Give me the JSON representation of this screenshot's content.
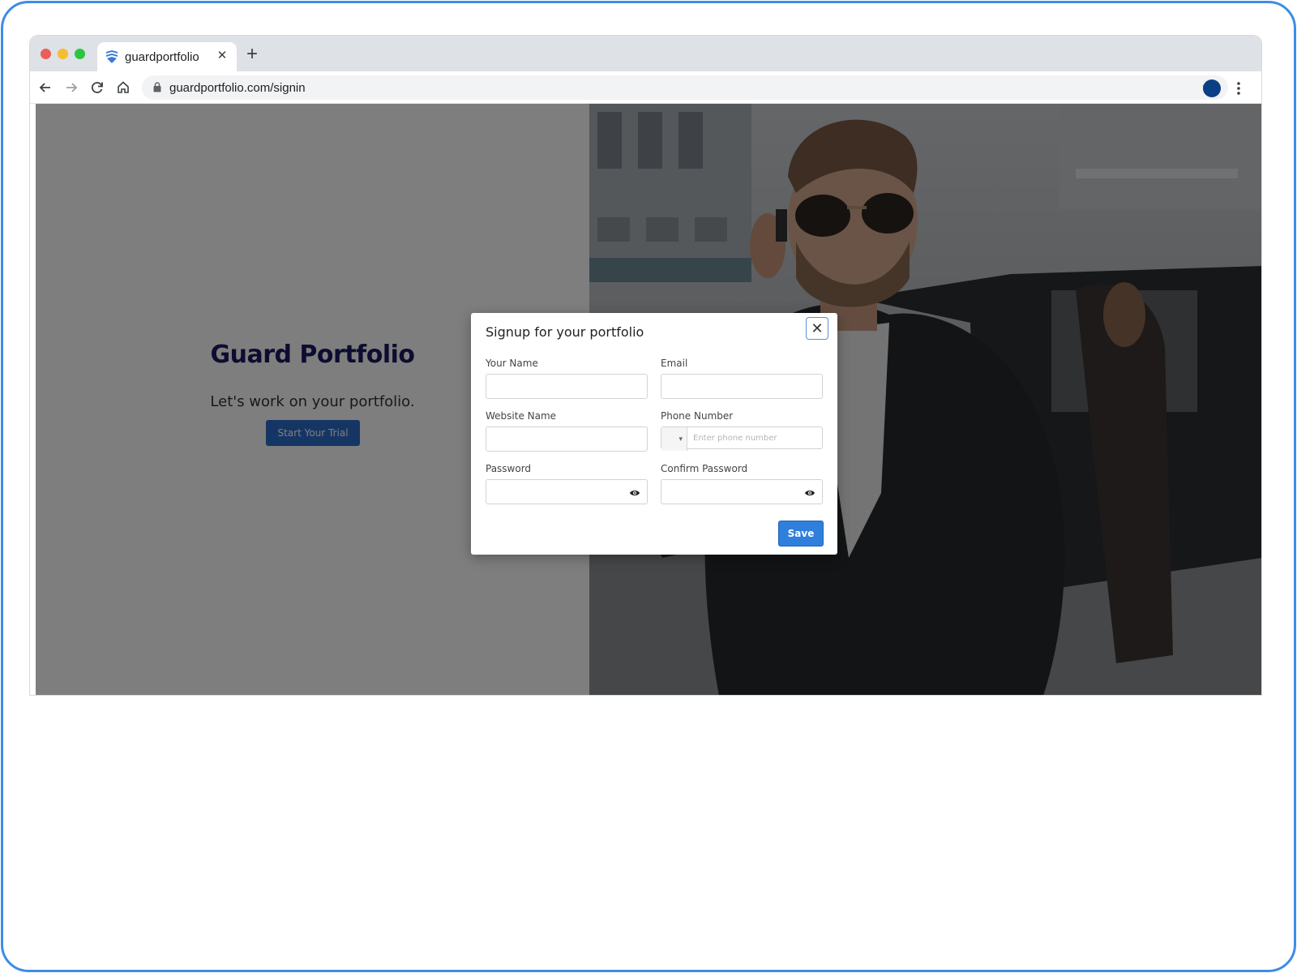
{
  "browser": {
    "tab_title": "guardportfolio",
    "tab_close": "✕",
    "new_tab": "+",
    "url": "guardportfolio.com/signin",
    "profile_color": "#0b3f85"
  },
  "landing": {
    "title": "Guard Portfolio",
    "tagline": "Let's work on your portfolio.",
    "trial_button": "Start Your Trial"
  },
  "modal": {
    "title": "Signup for your portfolio",
    "close_label": "✕",
    "fields": {
      "name_label": "Your Name",
      "email_label": "Email",
      "website_label": "Website Name",
      "phone_label": "Phone Number",
      "phone_placeholder": "Enter phone number",
      "phone_flag": "▾",
      "password_label": "Password",
      "confirm_password_label": "Confirm Password"
    },
    "save_button": "Save"
  },
  "colors": {
    "accent": "#2f7fdc",
    "brand_title": "#1a1960",
    "frame_border": "#3d8de5"
  }
}
